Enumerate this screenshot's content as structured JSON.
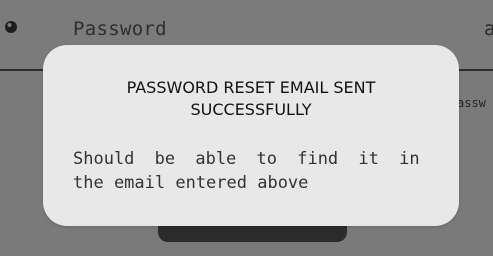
{
  "password_field": {
    "label": "Password",
    "icon": "key-icon",
    "edge_glyph": "a"
  },
  "background": {
    "partial_text": "assw"
  },
  "dialog": {
    "title_line1": "PASSWORD RESET EMAIL SENT",
    "title_line2": "SUCCESSFULLY",
    "message_line1": "Should be able to find it in",
    "message_line2": "the email entered above"
  },
  "colors": {
    "scrim": "#7a7a7a",
    "dialog_bg": "#e8e8e8",
    "button_bg": "#2b2b2b"
  }
}
